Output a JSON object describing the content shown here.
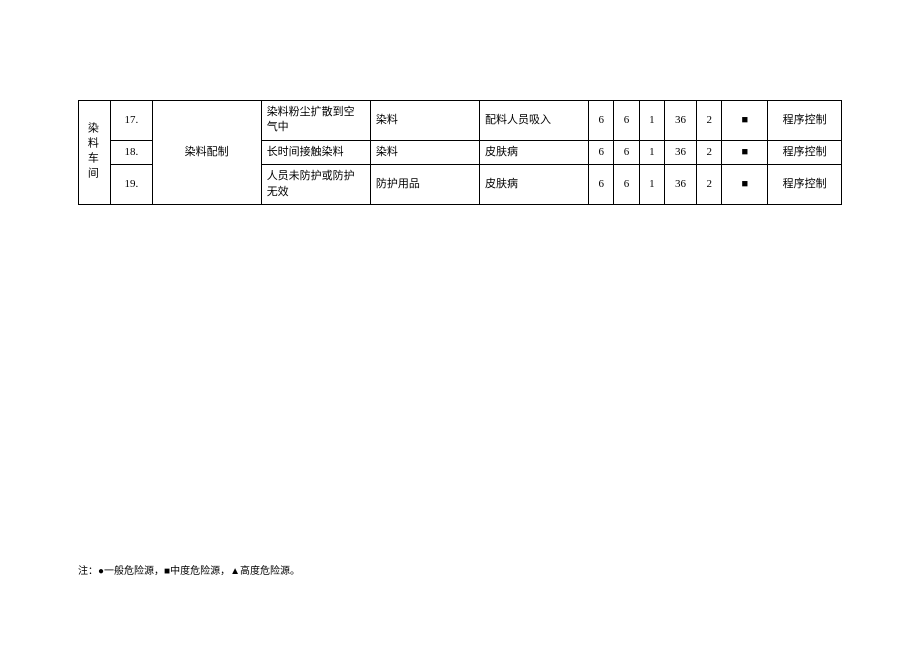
{
  "section_label": "染料车间",
  "process": "染料配制",
  "rows": [
    {
      "no": "17.",
      "hazard": "染料粉尘扩散到空气中",
      "source": "染料",
      "consequence": "配料人员吸入",
      "l": "6",
      "e": "6",
      "c": "1",
      "d": "36",
      "rank": "2",
      "symbol": "■",
      "control": "程序控制"
    },
    {
      "no": "18.",
      "hazard": "长时间接触染料",
      "source": "染料",
      "consequence": "皮肤病",
      "l": "6",
      "e": "6",
      "c": "1",
      "d": "36",
      "rank": "2",
      "symbol": "■",
      "control": "程序控制"
    },
    {
      "no": "19.",
      "hazard": "人员未防护或防护无效",
      "source": "防护用品",
      "consequence": "皮肤病",
      "l": "6",
      "e": "6",
      "c": "1",
      "d": "36",
      "rank": "2",
      "symbol": "■",
      "control": "程序控制"
    }
  ],
  "footnote": "注：●一般危险源，■中度危险源，▲高度危险源。"
}
